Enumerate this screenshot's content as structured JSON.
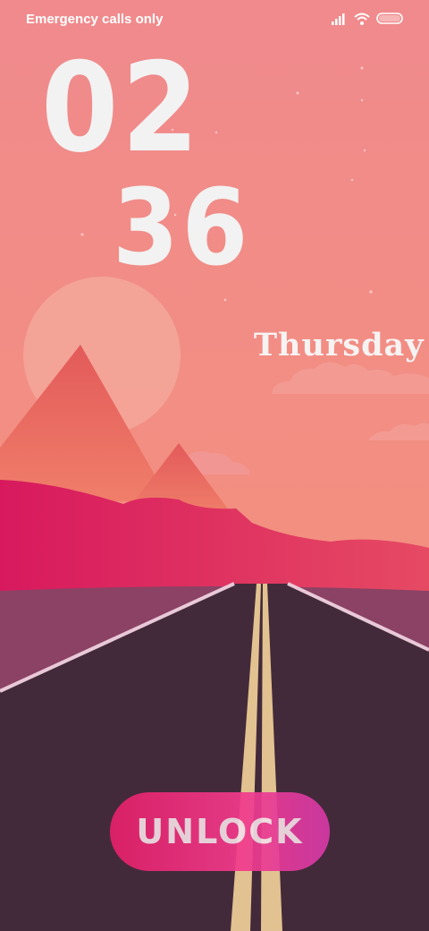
{
  "status_bar": {
    "carrier_text": "Emergency calls only",
    "icons": [
      "signal-icon",
      "wifi-icon",
      "battery-icon"
    ]
  },
  "clock": {
    "hour": "02",
    "minute": "36"
  },
  "date": {
    "day": "Thursday"
  },
  "unlock_button": {
    "label": "UNLOCK"
  },
  "colors": {
    "sky": "#f08a8a",
    "mountain": "#e45a5a",
    "hills": "#d61f5f",
    "road": "#432a3a",
    "road_side": "#8a4264",
    "center_line": "#e2c290",
    "unlock_gradient_start": "#e5206a",
    "unlock_gradient_end": "#d53aa8"
  }
}
